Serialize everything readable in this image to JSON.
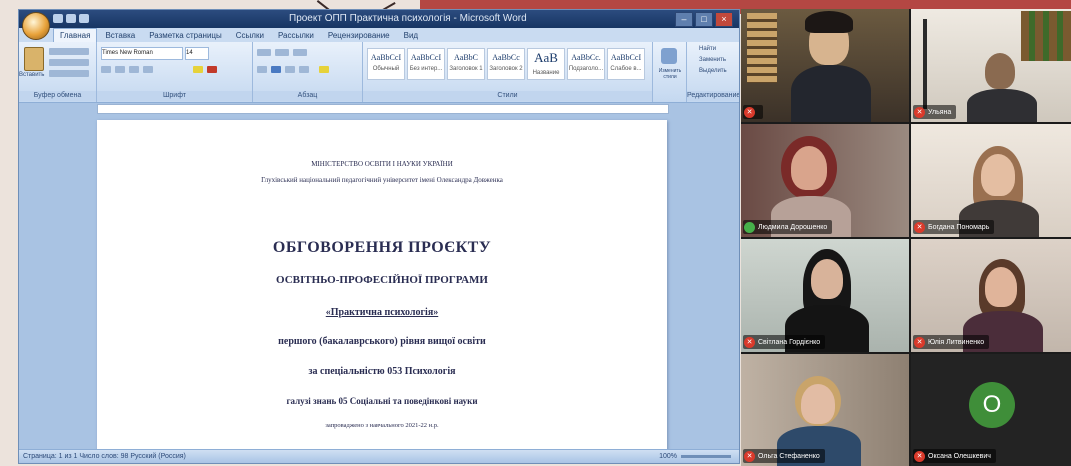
{
  "word": {
    "title": "Проект ОПП Практична психологія - Microsoft Word",
    "tabs": [
      {
        "label": "Главная",
        "active": true
      },
      {
        "label": "Вставка",
        "active": false
      },
      {
        "label": "Разметка страницы",
        "active": false
      },
      {
        "label": "Ссылки",
        "active": false
      },
      {
        "label": "Рассылки",
        "active": false
      },
      {
        "label": "Рецензирование",
        "active": false
      },
      {
        "label": "Вид",
        "active": false
      }
    ],
    "ribbon": {
      "groups": [
        "Буфер обмена",
        "Шрифт",
        "Абзац",
        "Стили",
        "Редактирование"
      ],
      "paste_label": "Вставить",
      "font_name": "Times New Roman",
      "font_size": "14",
      "styles": [
        {
          "sample": "AaBbCcI",
          "name": "Обычный"
        },
        {
          "sample": "AaBbCcI",
          "name": "Без интер..."
        },
        {
          "sample": "AaBbC",
          "name": "Заголовок 1"
        },
        {
          "sample": "AaBbCc",
          "name": "Заголовок 2"
        },
        {
          "sample": "AaB",
          "name": "Название"
        },
        {
          "sample": "AaBbCc.",
          "name": "Подзаголо..."
        },
        {
          "sample": "AaBbCcI",
          "name": "Слабое в..."
        }
      ],
      "change_styles_label": "Изменить стили",
      "find_label": "Найти",
      "replace_label": "Заменить",
      "select_label": "Выделить"
    },
    "document": {
      "ministry": "МІНІСТЕРСТВО ОСВІТИ І НАУКИ УКРАЇНИ",
      "university": "Глухівський національний педагогічний університет імені Олександра Довженка",
      "title": "ОБГОВОРЕННЯ ПРОЄКТУ",
      "program": "ОСВІТНЬО-ПРОФЕСІЙНОЇ ПРОГРАМИ",
      "program_name": "«Практична психологія»",
      "level": "першого (бакалаврського) рівня вищої освіти",
      "specialty": "за спеціальністю 053 Психологія",
      "field": "галузі знань 05 Соціальні та поведінкові науки",
      "date": "запроваджено з навчального 2021-22 н.р."
    },
    "status": {
      "left": "Страница: 1 из 1   Число слов: 98   Русский (Россия)",
      "right": "100%"
    }
  },
  "gallery": {
    "participants": [
      {
        "name": "",
        "muted": true
      },
      {
        "name": "Ульяна",
        "muted": true
      },
      {
        "name": "Людмила Дорошенко",
        "muted": false
      },
      {
        "name": "Богдана Пономарь",
        "muted": true
      },
      {
        "name": "Світлана Гордієнко",
        "muted": true
      },
      {
        "name": "Юлія Литвиненко",
        "muted": true
      },
      {
        "name": "Ольга Стефаненко",
        "muted": true
      },
      {
        "name": "Оксана Олешкевич",
        "muted": true,
        "avatar_letter": "O"
      }
    ],
    "muted_icon": "mic-off-icon",
    "unmuted_icon": "mic-on-icon",
    "avatar_color": "#3f8e39"
  },
  "colors": {
    "accent_band": "#b44743",
    "word_blue": "#a9c3e3",
    "muted_red": "#d93a2b"
  }
}
